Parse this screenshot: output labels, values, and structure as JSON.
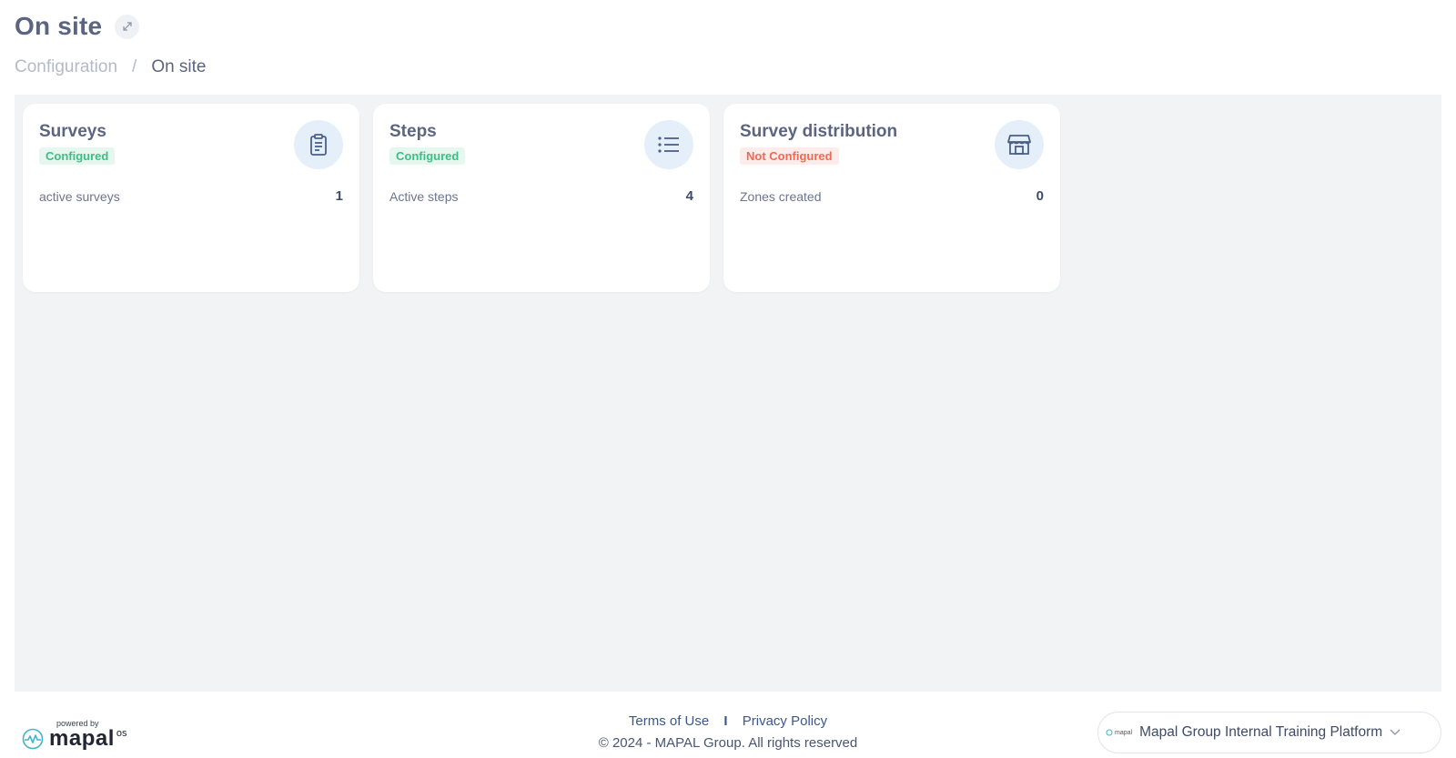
{
  "header": {
    "title": "On site",
    "breadcrumb": {
      "parent": "Configuration",
      "separator": "/",
      "current": "On site"
    }
  },
  "cards": [
    {
      "title": "Surveys",
      "status": "Configured",
      "icon": "clipboard-icon",
      "stat_label": "active surveys",
      "stat_value": "1"
    },
    {
      "title": "Steps",
      "status": "Configured",
      "icon": "list-icon",
      "stat_label": "Active steps",
      "stat_value": "4"
    },
    {
      "title": "Survey distribution",
      "status": "Not Configured",
      "icon": "store-icon",
      "stat_label": "Zones created",
      "stat_value": "0"
    }
  ],
  "footer": {
    "powered_by": "powered by",
    "brand": "mapal",
    "brand_suffix": "os",
    "terms": "Terms of Use",
    "link_separator": "I",
    "privacy": "Privacy Policy",
    "copyright": "© 2024 - MAPAL Group. All rights reserved",
    "org_logo_text": "mapal",
    "org_name": "Mapal Group Internal Training Platform"
  },
  "colors": {
    "configured": "#3dbf84",
    "not_configured": "#ef6a55",
    "icon_bg": "#e4effa",
    "content_bg": "#f2f3f5"
  }
}
